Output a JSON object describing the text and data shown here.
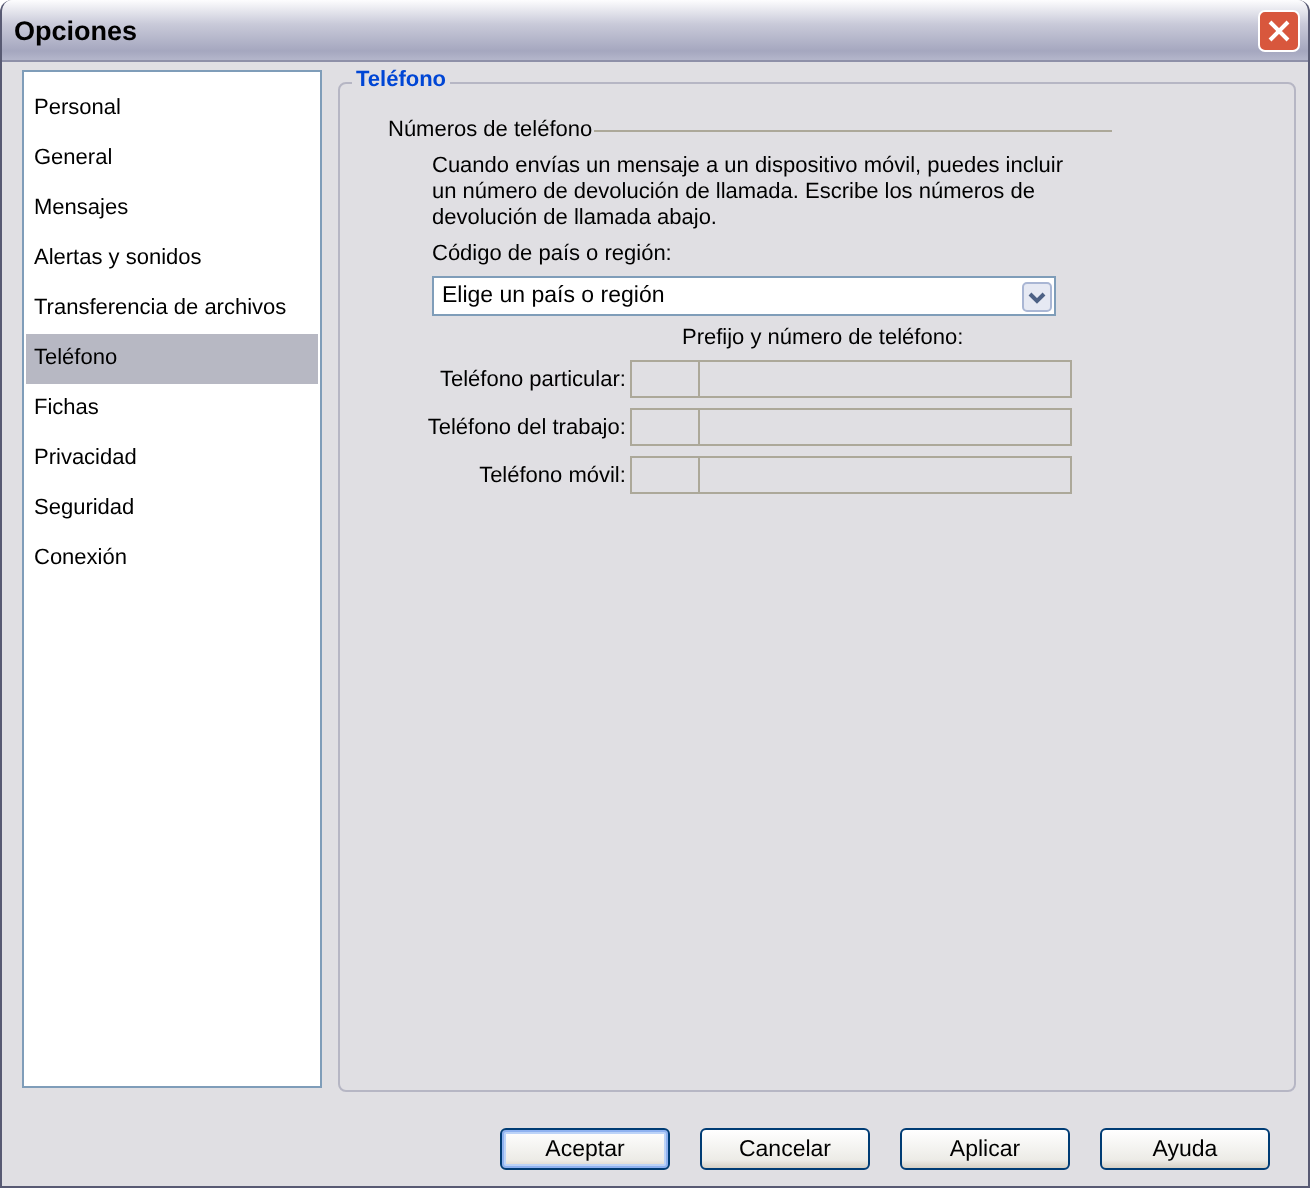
{
  "window": {
    "title": "Opciones"
  },
  "sidebar": {
    "items": [
      {
        "label": "Personal",
        "selected": false
      },
      {
        "label": "General",
        "selected": false
      },
      {
        "label": "Mensajes",
        "selected": false
      },
      {
        "label": "Alertas y sonidos",
        "selected": false
      },
      {
        "label": "Transferencia de archivos",
        "selected": false
      },
      {
        "label": "Teléfono",
        "selected": true
      },
      {
        "label": "Fichas",
        "selected": false
      },
      {
        "label": "Privacidad",
        "selected": false
      },
      {
        "label": "Seguridad",
        "selected": false
      },
      {
        "label": "Conexión",
        "selected": false
      }
    ]
  },
  "panel": {
    "title": "Teléfono",
    "group_title": "Números de teléfono",
    "description": "Cuando envías un mensaje a un dispositivo móvil, puedes incluir un número de devolución de llamada. Escribe los números de devolución de llamada abajo.",
    "country_label": "Código de país o región:",
    "country_dropdown": {
      "value": "Elige un país o región"
    },
    "phone_header": "Prefijo y número de teléfono:",
    "phones": [
      {
        "label": "Teléfono particular:",
        "disabled": true
      },
      {
        "label": "Teléfono del trabajo:",
        "disabled": true
      },
      {
        "label": "Teléfono móvil:",
        "disabled": true
      }
    ]
  },
  "buttons": [
    {
      "label": "Aceptar",
      "default": true
    },
    {
      "label": "Cancelar",
      "default": false
    },
    {
      "label": "Aplicar",
      "default": false
    },
    {
      "label": "Ayuda",
      "default": false
    }
  ]
}
